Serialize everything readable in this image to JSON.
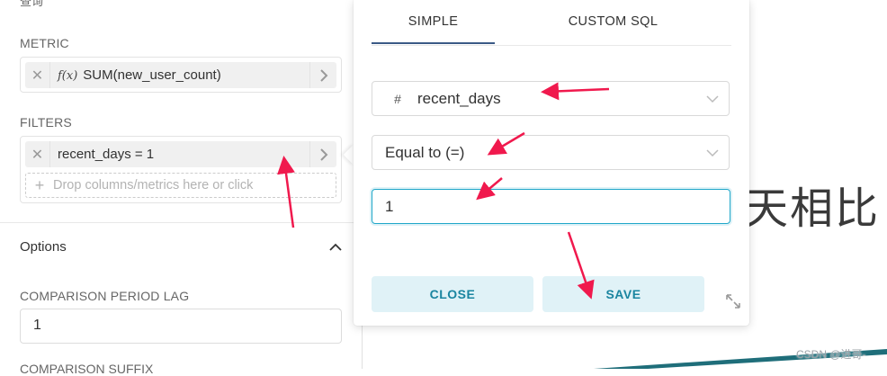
{
  "left_panel": {
    "cut_top_label": "查询",
    "metric": {
      "label": "METRIC",
      "fx_symbol": "f(x)",
      "value": "SUM(new_user_count)"
    },
    "filters": {
      "label": "FILTERS",
      "value": "recent_days = 1",
      "drop_placeholder": "Drop columns/metrics here or click"
    },
    "options": {
      "title": "Options",
      "comparison_period_lag": {
        "label": "COMPARISON PERIOD LAG",
        "value": "1"
      },
      "next_label_cut": "COMPARISON SUFFIX"
    }
  },
  "popover": {
    "tabs": [
      {
        "label": "SIMPLE",
        "active": true
      },
      {
        "label": "CUSTOM SQL",
        "active": false
      }
    ],
    "column_select": {
      "type_icon": "#",
      "value": "recent_days"
    },
    "operator_select": {
      "value": "Equal to (=)"
    },
    "value_input": "1",
    "buttons": {
      "close": "CLOSE",
      "save": "SAVE"
    }
  },
  "background": {
    "cjk_text": "天相比",
    "watermark": "CSDN @进哥-"
  },
  "colors": {
    "accent": "#20a7c9",
    "button_bg": "#e0f2f7",
    "button_text": "#1a85a0",
    "tab_underline": "#3b5a86",
    "annotation_arrow": "#f0194d"
  }
}
